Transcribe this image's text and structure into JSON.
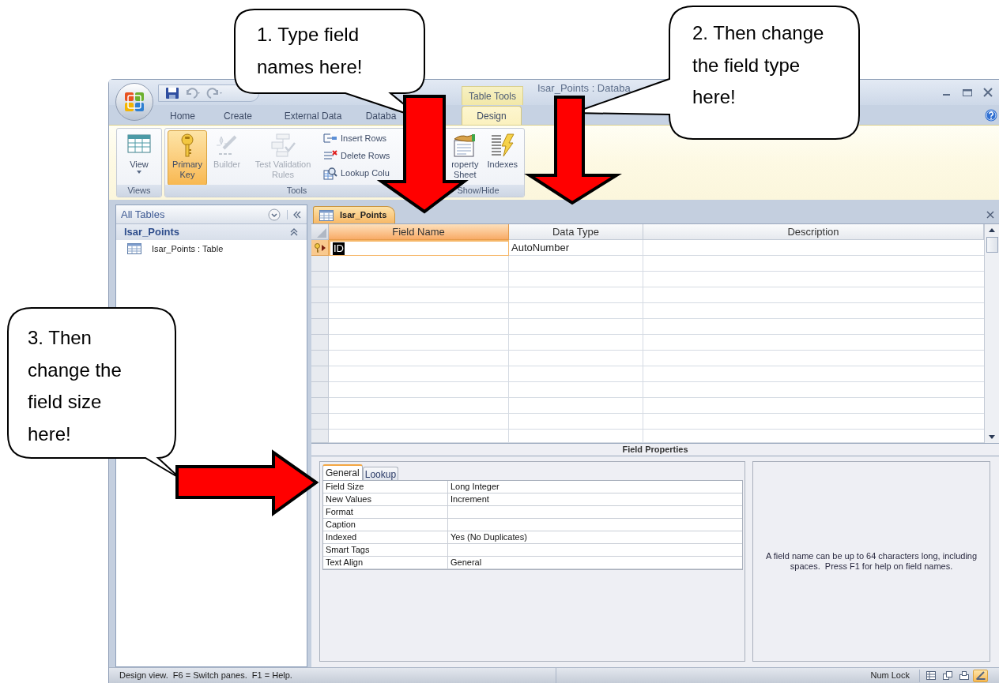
{
  "title_bar": {
    "contextual_tab": "Table Tools",
    "title": "Isar_Points : Databa"
  },
  "ribbon_tabs": [
    {
      "label": "Home",
      "selected": false
    },
    {
      "label": "Create",
      "selected": false
    },
    {
      "label": "External Data",
      "selected": false
    },
    {
      "label": "Databa",
      "selected": false
    },
    {
      "label": "Design",
      "selected": true
    }
  ],
  "ribbon_groups": [
    {
      "label": "Views",
      "buttons": [
        {
          "label": "View",
          "kind": "large",
          "pressed": false,
          "disabled": false,
          "has_menu": true
        }
      ]
    },
    {
      "label": "Tools",
      "buttons": [
        {
          "label": "Primary Key",
          "kind": "large",
          "pressed": true,
          "disabled": false
        },
        {
          "label": "Builder",
          "kind": "large",
          "pressed": false,
          "disabled": true
        },
        {
          "label": "Test Validation Rules",
          "kind": "large",
          "pressed": false,
          "disabled": true
        },
        {
          "label": "Insert Rows",
          "kind": "small",
          "pressed": false,
          "disabled": false
        },
        {
          "label": "Delete Rows",
          "kind": "small",
          "pressed": false,
          "disabled": false
        },
        {
          "label": "Lookup Colu",
          "kind": "small",
          "pressed": false,
          "disabled": false
        }
      ]
    },
    {
      "label": "Show/Hide",
      "buttons": [
        {
          "label": "roperty Sheet",
          "kind": "large",
          "pressed": false,
          "disabled": false
        },
        {
          "label": "Indexes",
          "kind": "large",
          "pressed": false,
          "disabled": false
        }
      ]
    }
  ],
  "navigation_pane": {
    "header": "All Tables",
    "group": {
      "label": "Isar_Points",
      "expanded": true
    },
    "items": [
      {
        "label": "Isar_Points : Table"
      }
    ]
  },
  "document_tab": {
    "label": "Isar_Points"
  },
  "design_grid": {
    "columns": [
      {
        "label": "Field Name",
        "selected": true
      },
      {
        "label": "Data Type",
        "selected": false
      },
      {
        "label": "Description",
        "selected": false
      }
    ],
    "rows": [
      {
        "field_name": "ID",
        "data_type": "AutoNumber",
        "primary_key": true,
        "selected": true
      }
    ]
  },
  "field_properties": {
    "title": "Field Properties",
    "tabs": [
      {
        "label": "General",
        "selected": true
      },
      {
        "label": "Lookup",
        "selected": false
      }
    ],
    "properties": [
      {
        "name": "Field Size",
        "value": "Long Integer"
      },
      {
        "name": "New Values",
        "value": "Increment"
      },
      {
        "name": "Format"
      },
      {
        "name": "Caption"
      },
      {
        "name": "Indexed",
        "value": "Yes (No Duplicates)"
      },
      {
        "name": "Smart Tags"
      },
      {
        "name": "Text Align",
        "value": "General"
      }
    ],
    "help_text": "A field name can be up to 64 characters long, including spaces.  Press F1 for help on field names."
  },
  "status_bar": {
    "message": "Design view.  F6 = Switch panes.  F1 = Help.",
    "indicator": "Num Lock",
    "view_buttons": [
      {
        "selected": false
      },
      {
        "selected": false
      },
      {
        "selected": false
      },
      {
        "selected": true
      }
    ]
  },
  "callouts": [
    {
      "text": "1. Type field names here!"
    },
    {
      "text": "2. Then change the field type here!"
    },
    {
      "text": "3. Then change the field size here!"
    }
  ]
}
